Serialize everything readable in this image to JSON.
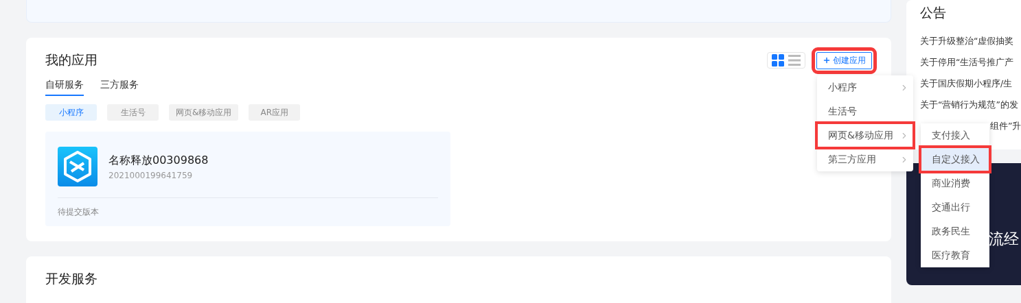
{
  "my_apps": {
    "title": "我的应用",
    "view_toggle": [
      {
        "kind": "grid",
        "selected": true
      },
      {
        "kind": "list",
        "selected": false
      }
    ],
    "create_button": {
      "label": "创建应用",
      "highlighted": true
    },
    "tabs": [
      {
        "label": "自研服务",
        "selected": true
      },
      {
        "label": "三方服务",
        "selected": false
      }
    ],
    "filters": [
      {
        "label": "小程序",
        "selected": true
      },
      {
        "label": "生活号",
        "selected": false
      },
      {
        "label": "网页&移动应用",
        "selected": false
      },
      {
        "label": "AR应用",
        "selected": false
      }
    ],
    "apps": [
      {
        "name": "名称释放00309868",
        "id": "2021000199641759",
        "status": "待提交版本"
      }
    ]
  },
  "dev_services": {
    "title": "开发服务"
  },
  "create_menu": {
    "items": [
      {
        "label": "小程序",
        "has_submenu": true,
        "highlighted": false
      },
      {
        "label": "生活号",
        "has_submenu": false,
        "highlighted": false
      },
      {
        "label": "网页&移动应用",
        "has_submenu": true,
        "highlighted": true
      },
      {
        "label": "第三方应用",
        "has_submenu": true,
        "highlighted": false
      }
    ],
    "submenu": [
      {
        "label": "支付接入",
        "selected": false,
        "highlighted": false
      },
      {
        "label": "自定义接入",
        "selected": true,
        "highlighted": true
      },
      {
        "label": "商业消费",
        "selected": false,
        "highlighted": false
      },
      {
        "label": "交通出行",
        "selected": false,
        "highlighted": false
      },
      {
        "label": "政务民生",
        "selected": false,
        "highlighted": false
      },
      {
        "label": "医疗教育",
        "selected": false,
        "highlighted": false
      }
    ]
  },
  "announcements": {
    "title": "公告",
    "items": [
      "关于升级整治“虚假抽奖",
      "关于停用“生活号推广产",
      "关于国庆假期小程序/生",
      "关于“营销行为规范”的发",
      "组件”升"
    ]
  },
  "banner": {
    "text": "流经"
  }
}
